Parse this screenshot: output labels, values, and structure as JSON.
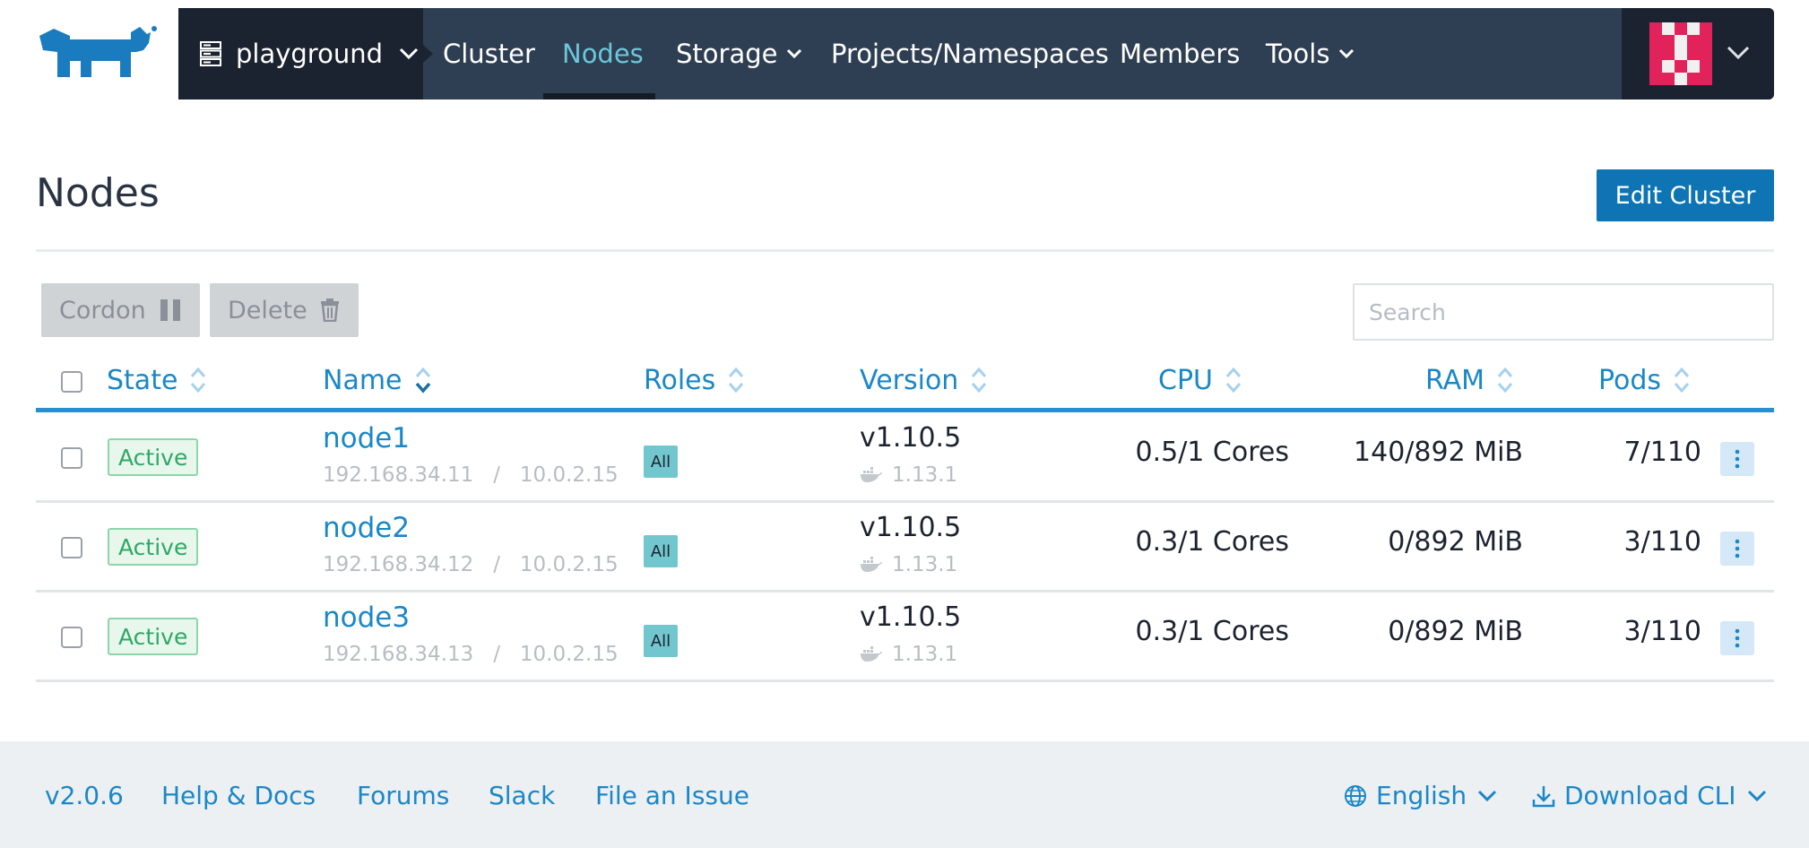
{
  "header": {
    "cluster_name": "playground",
    "nav": [
      {
        "label": "Cluster"
      },
      {
        "label": "Nodes"
      },
      {
        "label": "Storage"
      },
      {
        "label": "Projects/Namespaces"
      },
      {
        "label": "Members"
      },
      {
        "label": "Tools"
      }
    ],
    "active_nav": "Nodes"
  },
  "page": {
    "title": "Nodes",
    "edit_button_label": "Edit Cluster"
  },
  "bulk_actions": {
    "cordon_label": "Cordon",
    "delete_label": "Delete"
  },
  "search": {
    "placeholder": "Search",
    "value": ""
  },
  "table": {
    "columns": [
      "State",
      "Name",
      "Roles",
      "Version",
      "CPU",
      "RAM",
      "Pods"
    ],
    "sorted_column": "Name",
    "rows": [
      {
        "state": "Active",
        "name": "node1",
        "ips": "192.168.34.11   /   10.0.2.15",
        "role": "All",
        "k8s_version": "v1.10.5",
        "docker_version": "1.13.1",
        "cpu": "0.5/1 Cores",
        "ram": "140/892 MiB",
        "pods": "7/110"
      },
      {
        "state": "Active",
        "name": "node2",
        "ips": "192.168.34.12   /   10.0.2.15",
        "role": "All",
        "k8s_version": "v1.10.5",
        "docker_version": "1.13.1",
        "cpu": "0.3/1 Cores",
        "ram": "0/892 MiB",
        "pods": "3/110"
      },
      {
        "state": "Active",
        "name": "node3",
        "ips": "192.168.34.13   /   10.0.2.15",
        "role": "All",
        "k8s_version": "v1.10.5",
        "docker_version": "1.13.1",
        "cpu": "0.3/1 Cores",
        "ram": "0/892 MiB",
        "pods": "3/110"
      }
    ]
  },
  "footer": {
    "version": "v2.0.6",
    "help": "Help & Docs",
    "forums": "Forums",
    "slack": "Slack",
    "issue": "File an Issue",
    "language": "English",
    "download": "Download CLI"
  },
  "colors": {
    "nav_bg": "#2f3f53",
    "nav_dark": "#1c2330",
    "accent": "#1a87c7",
    "primary_button": "#0e74b3",
    "active_nav": "#6cc7d9",
    "state_active": "#2fa866"
  },
  "icons": {
    "logo": "rancher-logo",
    "cluster": "server-stack-icon",
    "avatar": "identicon-avatar",
    "cordon": "pause-icon",
    "delete": "trash-icon",
    "sort": "sort-arrows-icon",
    "docker": "docker-whale-icon",
    "row_menu": "vertical-dots-icon",
    "language": "globe-icon",
    "download": "download-icon"
  }
}
